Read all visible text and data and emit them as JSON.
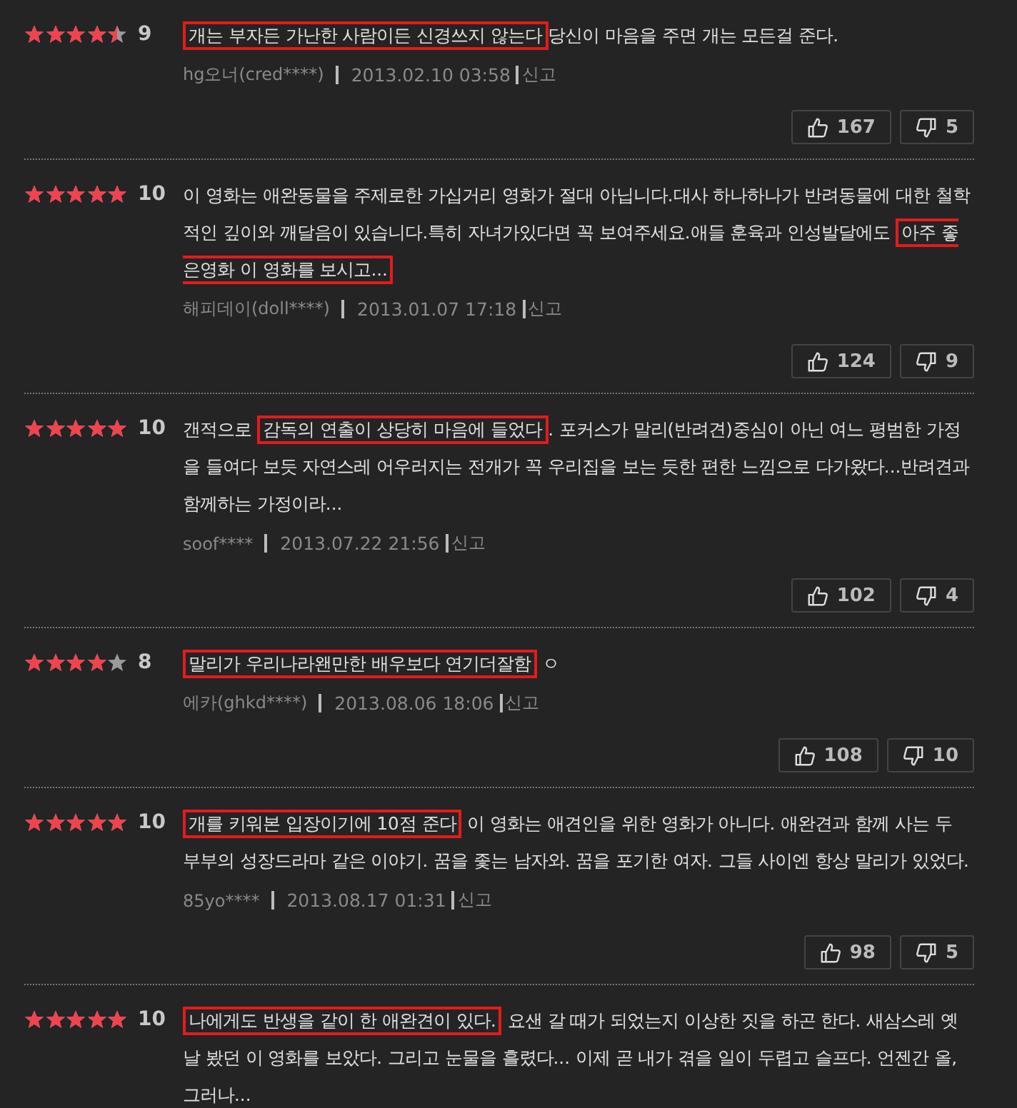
{
  "reviews": [
    {
      "stars": 4.5,
      "score": "9",
      "highlight": "개는 부자든 가난한 사람이든 신경쓰지 않는다",
      "after": "당신이 마음을 주면 개는 모든걸 준다.",
      "author": "hg오너(cred****)",
      "date": "2013.02.10 03:58",
      "report": "신고",
      "likes": "167",
      "dislikes": "5"
    },
    {
      "stars": 5,
      "score": "10",
      "before": "이 영화는 애완동물을 주제로한 가십거리 영화가 절대 아닙니다.대사 하나하나가 반려동물에 대한 철학적인 깊이와 깨달음이 있습니다.특히 자녀가있다면 꼭 보여주세요.애들 훈육과 인성발달에도 ",
      "highlight": "아주 좋은영화 이 영화를 보시고...",
      "author": "해피데이(doll****)",
      "date": "2013.01.07 17:18",
      "report": "신고",
      "likes": "124",
      "dislikes": "9"
    },
    {
      "stars": 5,
      "score": "10",
      "before": "갠적으로 ",
      "highlight": "감독의 연출이 상당히 마음에 들었다",
      "after": ". 포커스가 말리(반려견)중심이 아닌 여느 평범한 가정을 들여다 보듯 자연스레 어우러지는 전개가 꼭 우리집을 보는 듯한 편한 느낌으로 다가왔다...반려견과 함께하는 가정이라...",
      "author": "soof****",
      "date": "2013.07.22 21:56",
      "report": "신고",
      "likes": "102",
      "dislikes": "4"
    },
    {
      "stars": 4,
      "score": "8",
      "highlight": "말리가 우리나라왠만한 배우보다 연기더잘함",
      "after": " ㅇ",
      "author": "에카(ghkd****)",
      "date": "2013.08.06 18:06",
      "report": "신고",
      "likes": "108",
      "dislikes": "10"
    },
    {
      "stars": 5,
      "score": "10",
      "highlight": "개를 키워본 입장이기에 10점 준다",
      "after": "  이 영화는 애견인을 위한 영화가 아니다. 애완견과 함께 사는 두 부부의 성장드라마 같은 이야기. 꿈을 좇는 남자와. 꿈을 포기한 여자. 그들 사이엔 항상 말리가 있었다.",
      "author": "85yo****",
      "date": "2013.08.17 01:31",
      "report": "신고",
      "likes": "98",
      "dislikes": "5"
    },
    {
      "stars": 5,
      "score": "10",
      "highlight": "나에게도 반생을 같이 한 애완견이 있다.",
      "after": " 요샌 갈 때가 되었는지 이상한 짓을 하곤 한다. 새삼스레 옛날 봤던 이 영화를 보았다. 그리고 눈물을 흘렸다... 이제 곧 내가 겪을 일이 두렵고 슬프다. 언젠간 올, 그러나..."
    }
  ]
}
